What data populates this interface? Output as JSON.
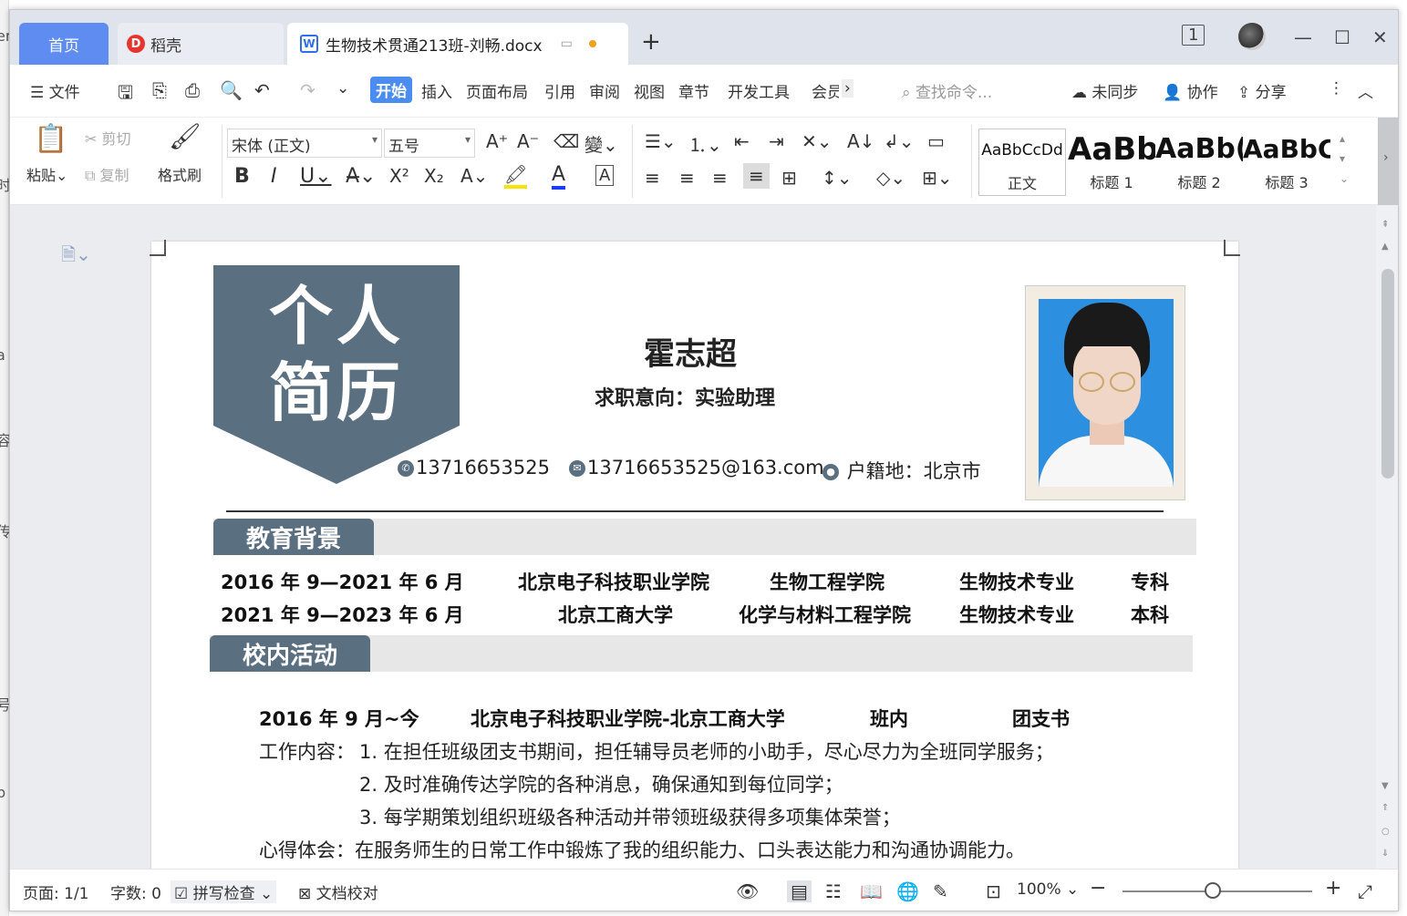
{
  "tabs": {
    "home": "首页",
    "daoke": "稻壳",
    "doc": "生物技术贯通213班-刘畅.docx"
  },
  "menu": {
    "file": "文件",
    "items": [
      "开始",
      "插入",
      "页面布局",
      "引用",
      "审阅",
      "视图",
      "章节",
      "开发工具",
      "会员"
    ],
    "search_placeholder": "查找命令...",
    "unsynced": "未同步",
    "collab": "协作",
    "share": "分享"
  },
  "ribbon": {
    "paste": "粘贴",
    "cut": "剪切",
    "copy": "复制",
    "format_painter": "格式刷",
    "font_name": "宋体 (正文)",
    "font_size": "五号",
    "styles": [
      {
        "preview": "AaBbCcDd",
        "name": "正文"
      },
      {
        "preview": "AaBb",
        "name": "标题 1"
      },
      {
        "preview": "AaBb(",
        "name": "标题 2"
      },
      {
        "preview": "AaBbC",
        "name": "标题 3"
      }
    ]
  },
  "resume": {
    "banner_line1": "个人",
    "banner_line2": "简历",
    "name": "霍志超",
    "intent": "求职意向：实验助理",
    "phone": "13716653525",
    "email": "13716653525@163.com",
    "hometown": "户籍地：北京市",
    "section_edu": "教育背景",
    "edu": [
      {
        "period": "2016 年 9—2021 年 6 月",
        "school": "北京电子科技职业学院",
        "college": "生物工程学院",
        "major": "生物技术专业",
        "degree": "专科"
      },
      {
        "period": "2021 年 9—2023 年 6 月",
        "school": "北京工商大学",
        "college": "化学与材料工程学院",
        "major": "生物技术专业",
        "degree": "本科"
      }
    ],
    "section_activity": "校内活动",
    "activity": {
      "period": "2016 年 9 月~今",
      "org": "北京电子科技职业学院-北京工商大学",
      "scope": "班内",
      "role": "团支书",
      "work_label": "工作内容：",
      "items": [
        "1. 在担任班级团支书期间，担任辅导员老师的小助手，尽心尽力为全班同学服务；",
        "2. 及时准确传达学院的各种消息，确保通知到每位同学；",
        "3. 每学期策划组织班级各种活动并带领班级获得多项集体荣誉；"
      ],
      "reflection": "心得体会：在服务师生的日常工作中锻炼了我的组织能力、口头表达能力和沟通协调能力。"
    }
  },
  "status": {
    "page": "页面: 1/1",
    "words": "字数: 0",
    "spell": "拼写检查",
    "proof": "文档校对",
    "zoom": "100%"
  },
  "colors": {
    "accent": "#4a8cf0",
    "home_tab": "#5e8cf0",
    "resume_slate": "#5a6f80"
  }
}
